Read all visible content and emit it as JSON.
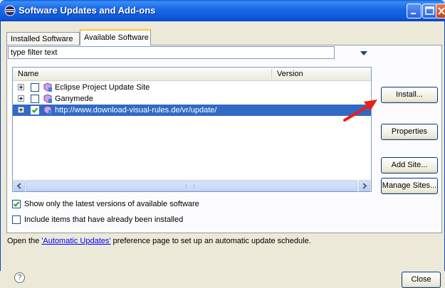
{
  "window": {
    "title": "Software Updates and Add-ons",
    "titlebar_color": "#0b55d6"
  },
  "tabs": [
    {
      "label": "Installed Software",
      "selected": false
    },
    {
      "label": "Available Software",
      "selected": true
    }
  ],
  "filter": {
    "value": "type filter text"
  },
  "tree": {
    "columns": {
      "name": "Name",
      "version": "Version"
    },
    "rows": [
      {
        "label": "Eclipse Project Update Site",
        "checked": false,
        "selected": false,
        "icon": "update-site-icon"
      },
      {
        "label": "Ganymede",
        "checked": false,
        "selected": false,
        "icon": "update-site-icon"
      },
      {
        "label": "http://www.download-visual-rules.de/vr/update/",
        "checked": true,
        "selected": true,
        "icon": "update-site-icon"
      }
    ],
    "selection_color": "#316ac5"
  },
  "buttons": {
    "install": "Install...",
    "properties": "Properties",
    "add_site": "Add Site...",
    "manage_sites": "Manage Sites...",
    "close": "Close"
  },
  "options": {
    "latest_label": "Show only the latest versions of available software",
    "latest_checked": true,
    "installed_label": "Include items that have already been installed",
    "installed_checked": false
  },
  "info": {
    "prefix": "Open the ",
    "link": "'Automatic Updates'",
    "suffix": " preference page to set up an automatic update schedule."
  },
  "help": {
    "glyph": "?"
  },
  "annotation": {
    "arrow_color": "#e8201a",
    "points_to": "install-button"
  }
}
